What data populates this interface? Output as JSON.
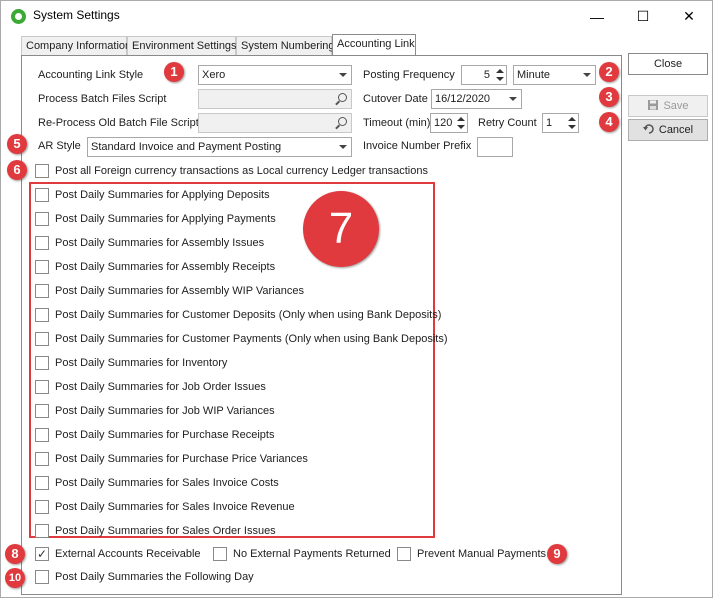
{
  "window": {
    "title": "System Settings",
    "minimize": "—",
    "maximize": "☐",
    "close": "✕"
  },
  "tabs": [
    {
      "label": "Company Information"
    },
    {
      "label": "Environment Settings"
    },
    {
      "label": "System Numbering"
    },
    {
      "label": "Accounting Link"
    }
  ],
  "form": {
    "link_style_label": "Accounting Link Style",
    "link_style_value": "Xero",
    "batch_script_label": "Process Batch Files Script",
    "reprocess_label": "Re-Process Old Batch File Script",
    "ar_style_label": "AR Style",
    "ar_style_value": "Standard Invoice and Payment Posting",
    "posting_freq_label": "Posting Frequency",
    "posting_freq_value": "5",
    "posting_freq_unit": "Minute",
    "cutover_label": "Cutover Date",
    "cutover_value": "16/12/2020",
    "timeout_label": "Timeout (min)",
    "timeout_value": "120",
    "retry_label": "Retry Count",
    "retry_value": "1",
    "invoice_prefix_label": "Invoice Number Prefix",
    "invoice_prefix_value": ""
  },
  "foreign_currency": {
    "label": "Post all Foreign currency transactions as Local currency Ledger transactions",
    "checked": false
  },
  "daily_summaries": [
    "Post Daily Summaries for Applying Deposits",
    "Post Daily Summaries for Applying Payments",
    "Post Daily Summaries for Assembly Issues",
    "Post Daily Summaries for Assembly Receipts",
    "Post Daily Summaries for Assembly WIP Variances",
    "Post Daily Summaries for Customer Deposits (Only when using Bank Deposits)",
    "Post Daily Summaries for Customer Payments (Only when using Bank Deposits)",
    "Post Daily Summaries for Inventory",
    "Post Daily Summaries for Job Order Issues",
    "Post Daily Summaries for Job WIP Variances",
    "Post Daily Summaries for Purchase Receipts",
    "Post Daily Summaries for Purchase Price Variances",
    "Post Daily Summaries for Sales Invoice Costs",
    "Post Daily Summaries for Sales Invoice Revenue",
    "Post Daily Summaries for Sales Order Issues"
  ],
  "bottom": {
    "external_ar": "External Accounts Receivable",
    "external_ar_check": "✓",
    "no_ext_payments": "No External Payments Returned",
    "prevent_manual": "Prevent Manual Payments",
    "following_day": "Post Daily Summaries the Following Day"
  },
  "buttons": {
    "close": "Close",
    "save": "Save",
    "cancel": "Cancel"
  },
  "badges": [
    "1",
    "2",
    "3",
    "4",
    "5",
    "6",
    "7",
    "8",
    "9",
    "10"
  ],
  "colors": {
    "badge": "#e0393e",
    "brand": "#3aaa35"
  }
}
